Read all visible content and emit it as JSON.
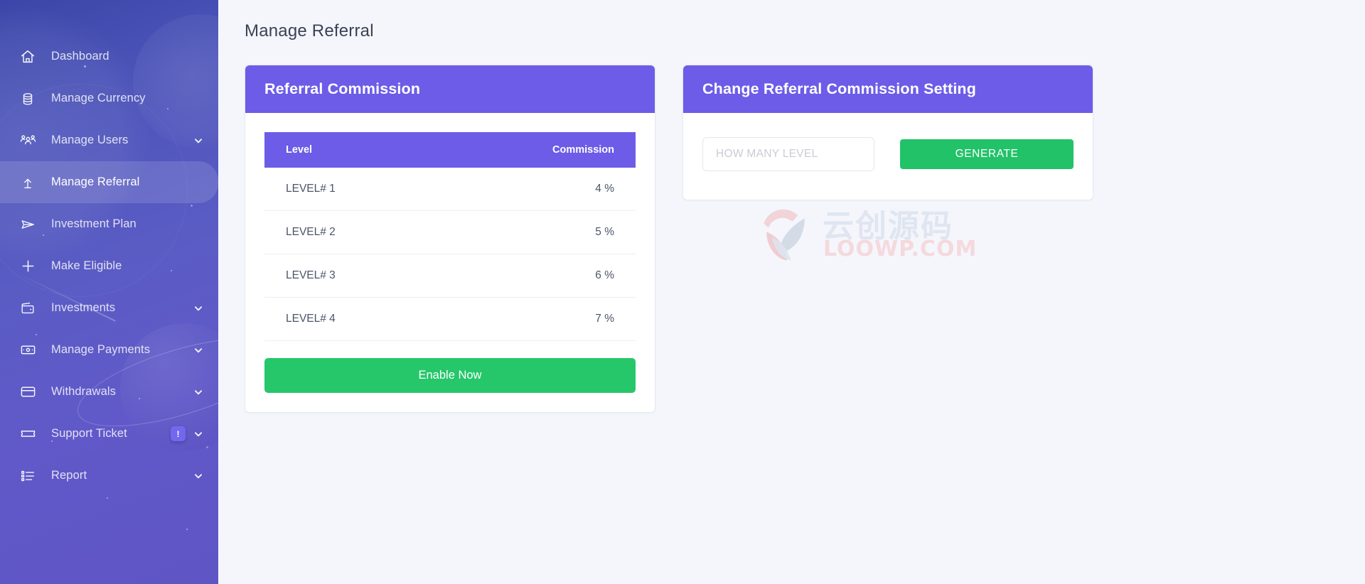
{
  "sidebar": {
    "items": [
      {
        "label": "Dashboard",
        "icon": "home-icon",
        "chevron": false,
        "active": false,
        "badge": null
      },
      {
        "label": "Manage Currency",
        "icon": "coins-icon",
        "chevron": false,
        "active": false,
        "badge": null
      },
      {
        "label": "Manage Users",
        "icon": "users-icon",
        "chevron": true,
        "active": false,
        "badge": null
      },
      {
        "label": "Manage Referral",
        "icon": "arrow-up-icon",
        "chevron": false,
        "active": true,
        "badge": null
      },
      {
        "label": "Investment Plan",
        "icon": "send-icon",
        "chevron": false,
        "active": false,
        "badge": null
      },
      {
        "label": "Make Eligible",
        "icon": "plus-icon",
        "chevron": false,
        "active": false,
        "badge": null
      },
      {
        "label": "Investments",
        "icon": "wallet-icon",
        "chevron": true,
        "active": false,
        "badge": null
      },
      {
        "label": "Manage Payments",
        "icon": "money-icon",
        "chevron": true,
        "active": false,
        "badge": null
      },
      {
        "label": "Withdrawals",
        "icon": "card-icon",
        "chevron": true,
        "active": false,
        "badge": null
      },
      {
        "label": "Support Ticket",
        "icon": "ticket-icon",
        "chevron": true,
        "active": false,
        "badge": "!"
      },
      {
        "label": "Report",
        "icon": "list-icon",
        "chevron": true,
        "active": false,
        "badge": null
      }
    ]
  },
  "page": {
    "title": "Manage Referral"
  },
  "referral_card": {
    "title": "Referral Commission",
    "table": {
      "columns": [
        "Level",
        "Commission"
      ],
      "rows": [
        {
          "level": "LEVEL# 1",
          "commission": "4 %"
        },
        {
          "level": "LEVEL# 2",
          "commission": "5 %"
        },
        {
          "level": "LEVEL# 3",
          "commission": "6 %"
        },
        {
          "level": "LEVEL# 4",
          "commission": "7 %"
        }
      ]
    },
    "enable_button": "Enable Now"
  },
  "setting_card": {
    "title": "Change Referral Commission Setting",
    "level_input": {
      "value": "",
      "placeholder": "HOW MANY LEVEL"
    },
    "generate_button": "GENERATE"
  },
  "watermark": {
    "text_cn": "云创源码",
    "text_domain": "LOOWP.COM"
  },
  "colors": {
    "accent_purple": "#6c5ce7",
    "green": "#26c76a",
    "sidebar_from": "#3b46a8",
    "sidebar_to": "#5f55c4",
    "page_bg": "#f4f6fb",
    "title_text": "#3a4256"
  }
}
